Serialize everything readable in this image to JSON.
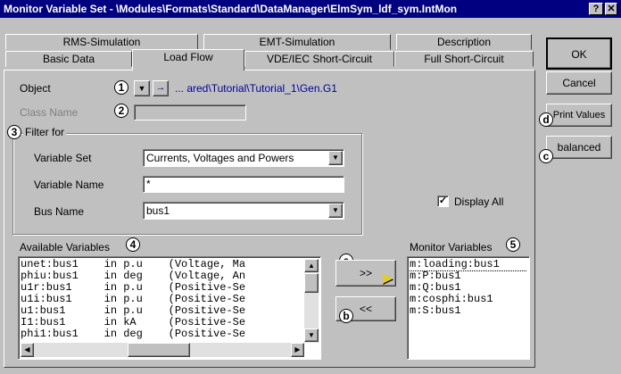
{
  "window": {
    "title": "Monitor Variable Set - \\Modules\\Formats\\Standard\\DataManager\\ElmSym_ldf_sym.IntMon",
    "help_btn": "?",
    "close_btn": "✕"
  },
  "tabs_row1": [
    "RMS-Simulation",
    "EMT-Simulation",
    "Description"
  ],
  "tabs_row2": [
    "Basic Data",
    "Load Flow",
    "VDE/IEC Short-Circuit",
    "Full Short-Circuit"
  ],
  "callouts": {
    "one": "1",
    "two": "2",
    "three": "3",
    "four": "4",
    "five": "5",
    "a": "a",
    "b": "b",
    "c": "c",
    "d": "d"
  },
  "object": {
    "label": "Object",
    "value": "... ared\\Tutorial\\Tutorial_1\\Gen.G1",
    "down_glyph": "▼",
    "goto_glyph": "→"
  },
  "class_name": {
    "label": "Class Name",
    "value": ""
  },
  "filter": {
    "title": "Filter for",
    "variable_set_label": "Variable Set",
    "variable_set_value": "Currents, Voltages and Powers",
    "variable_name_label": "Variable Name",
    "variable_name_value": "*",
    "bus_name_label": "Bus Name",
    "bus_name_value": "bus1",
    "display_all_label": "Display All",
    "display_all_checked": true
  },
  "available": {
    "label": "Available Variables",
    "rows": [
      "unet:bus1    in p.u    (Voltage, Ma",
      "phiu:bus1    in deg    (Voltage, An",
      "u1r:bus1     in p.u    (Positive-Se",
      "u1i:bus1     in p.u    (Positive-Se",
      "u1:bus1      in p.u    (Positive-Se",
      "I1:bus1      in kA     (Positive-Se",
      "phi1:bus1    in deg    (Positive-Se"
    ]
  },
  "transfer": {
    "add": ">>",
    "remove": "<<"
  },
  "monitor": {
    "label": "Monitor Variables",
    "rows": [
      "m:loading:bus1",
      "m:P:bus1",
      "m:Q:bus1",
      "m:cosphi:bus1",
      "m:S:bus1"
    ]
  },
  "buttons": {
    "ok": "OK",
    "cancel": "Cancel",
    "print_values": "Print Values",
    "balanced": "balanced"
  },
  "colors": {
    "titlebar": "#000080",
    "dialog": "#c0c0c0",
    "object_path": "#0000a0"
  }
}
